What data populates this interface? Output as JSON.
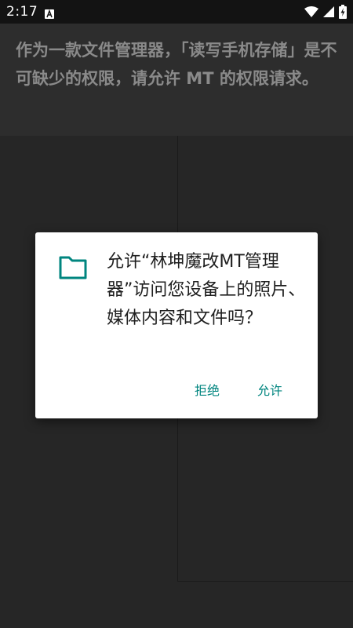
{
  "status_bar": {
    "time": "2:17",
    "notification_icon": "a-letter-icon",
    "icons": [
      "wifi-icon",
      "signal-icon",
      "battery-charging-icon"
    ]
  },
  "banner": {
    "text": "作为一款文件管理器，「读写手机存储」是不可缺少的权限，请允许 MT 的权限请求。"
  },
  "dialog": {
    "icon": "folder-icon",
    "message": "允许“林坤魔改MT管理器”访问您设备上的照片、媒体内容和文件吗？",
    "deny_label": "拒绝",
    "allow_label": "允许"
  },
  "colors": {
    "accent": "#00857f",
    "background": "#262626",
    "status_bar": "#131313",
    "banner": "#2d2d2d"
  }
}
